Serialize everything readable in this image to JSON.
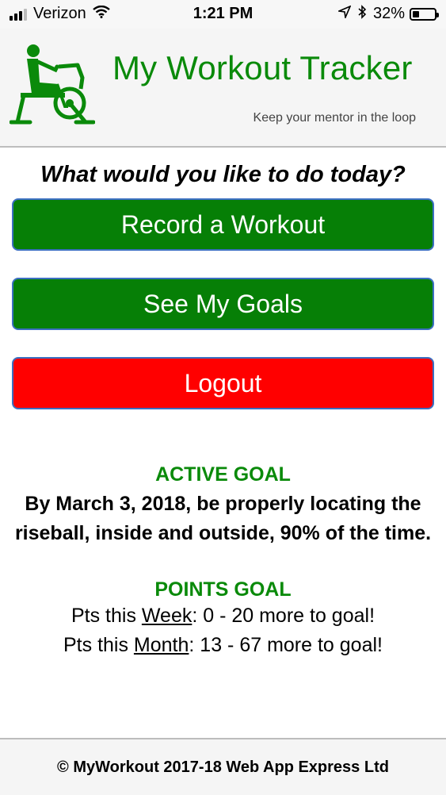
{
  "status_bar": {
    "carrier": "Verizon",
    "time": "1:21 PM",
    "battery_percent": "32%",
    "battery_level": 0.32,
    "icons": [
      "signal-icon",
      "wifi-icon",
      "location-arrow-icon",
      "bluetooth-icon",
      "battery-icon"
    ]
  },
  "header": {
    "title": "My Workout Tracker",
    "tagline": "Keep your mentor in the loop",
    "logo_icon": "exercise-bike-icon",
    "brand_color": "#0a8a0a"
  },
  "main": {
    "prompt": "What would you like to do today?",
    "buttons": {
      "record": "Record a Workout",
      "goals": "See My Goals",
      "logout": "Logout"
    },
    "button_colors": {
      "primary": "#067f06",
      "logout": "#ff0000"
    }
  },
  "active_goal": {
    "heading": "ACTIVE GOAL",
    "text": "By March 3, 2018, be properly locating the riseball, inside and outside, 90% of the time."
  },
  "points_goal": {
    "heading": "POINTS GOAL",
    "week": {
      "prefix": "Pts this ",
      "period": "Week",
      "suffix": ": 0 - 20 more to goal!"
    },
    "month": {
      "prefix": "Pts this ",
      "period": "Month",
      "suffix": ": 13 - 67 more to goal!"
    }
  },
  "footer": {
    "text": "© MyWorkout 2017-18 Web App Express Ltd"
  }
}
